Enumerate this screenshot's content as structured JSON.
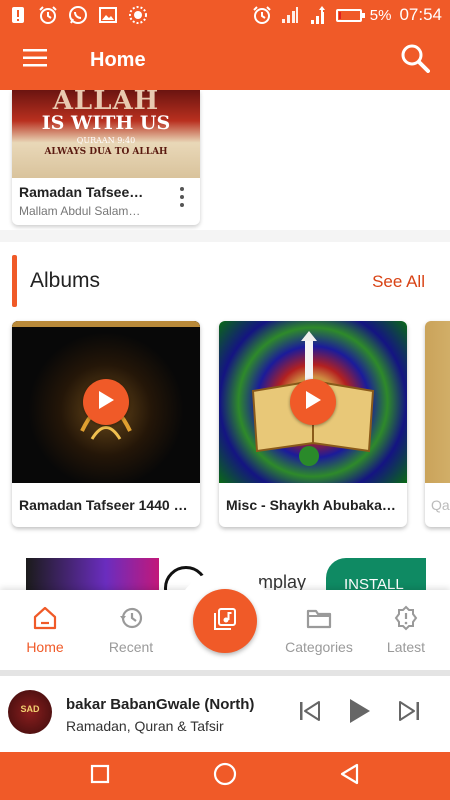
{
  "status_bar": {
    "battery_percent": "5%",
    "time": "07:54",
    "battery_level": 0.05,
    "left_icons": [
      "warning-icon",
      "alarm-icon",
      "whatsapp-icon",
      "image-icon",
      "app-badge-icon"
    ],
    "right_icons": [
      "alarm-icon",
      "signal-icon",
      "data-signal-icon",
      "battery-icon"
    ]
  },
  "app_bar": {
    "title": "Home",
    "menu_icon": "hamburger-menu-icon",
    "search_icon": "search-icon"
  },
  "top_card": {
    "thumb_line1": "ALLAH",
    "thumb_line2": "IS WITH US",
    "thumb_line3": "QURAAN 9:40",
    "thumb_line4": "ALWAYS DUA TO ALLAH",
    "title": "Ramadan Tafsee…",
    "subtitle": "Mallam Abdul Salam…"
  },
  "albums_section": {
    "title": "Albums",
    "see_all": "See All",
    "items": [
      {
        "title": "Ramadan Tafseer 1440 …"
      },
      {
        "title": "Misc - Shaykh Abubaka…"
      },
      {
        "title": "Qa"
      }
    ]
  },
  "ad": {
    "text": "mplay",
    "install_label": "INSTALL"
  },
  "bottom_nav": {
    "items": [
      {
        "label": "Home",
        "icon": "home-icon",
        "active": true
      },
      {
        "label": "Recent",
        "icon": "history-icon",
        "active": false
      },
      {
        "label": "Categories",
        "icon": "folder-icon",
        "active": false
      },
      {
        "label": "Latest",
        "icon": "gear-badge-icon",
        "active": false
      }
    ],
    "fab_icon": "music-library-icon"
  },
  "player": {
    "title": "bakar BabanGwale (North)",
    "subtitle": "Ramadan, Quran & Tafsir",
    "art_text": "SAD"
  },
  "colors": {
    "accent": "#f05a28",
    "see_all": "#d84315",
    "install": "#0f8a63"
  }
}
